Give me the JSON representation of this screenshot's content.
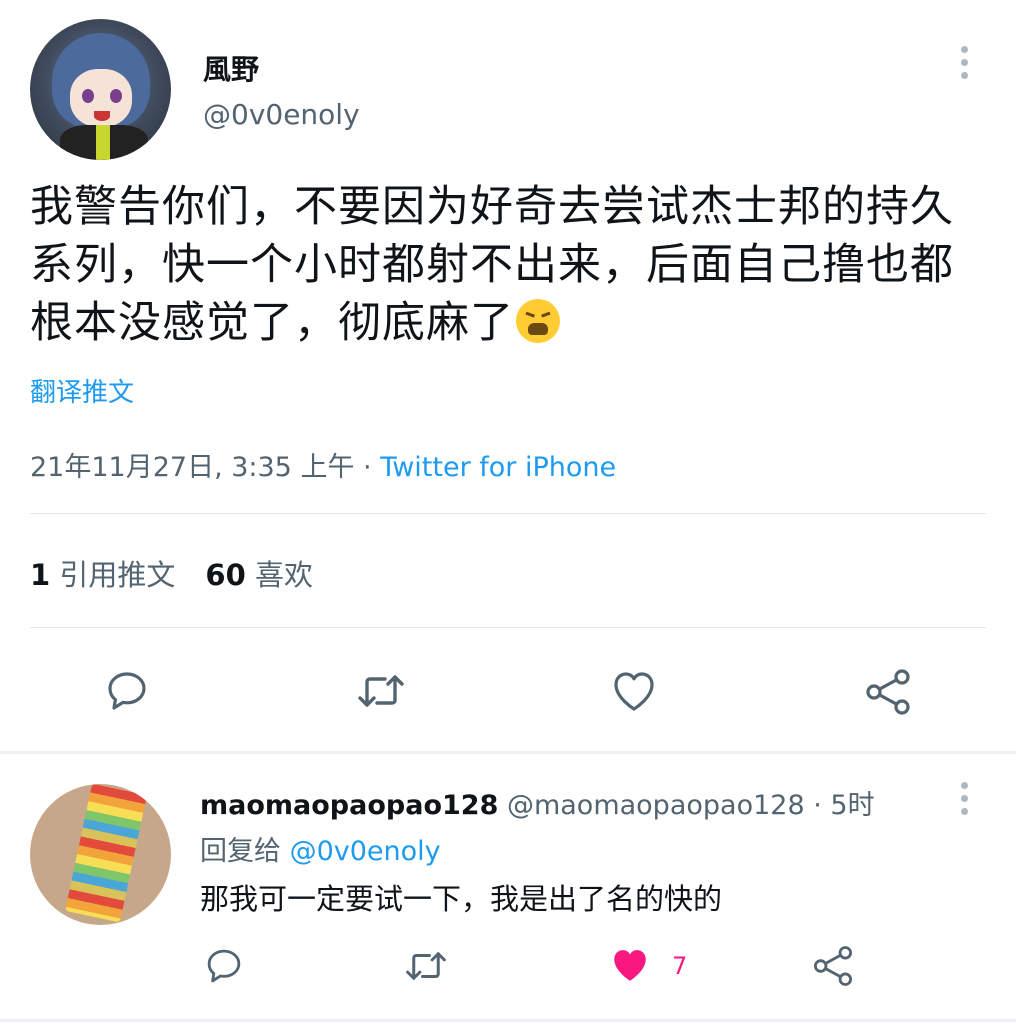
{
  "tweet": {
    "author_name": "風野",
    "author_handle": "@0v0enoly",
    "text": "我警告你们，不要因为好奇去尝试杰士邦的持久系列，快一个小时都射不出来，后面自己撸也都根本没感觉了，彻底麻了",
    "translate_label": "翻译推文",
    "timestamp": "21年11月27日, 3:35 上午",
    "separator": " · ",
    "source": "Twitter for iPhone",
    "quote_count": "1",
    "quote_label": "引用推文",
    "like_count": "60",
    "like_label": "喜欢"
  },
  "reply": {
    "author_name": "maomaopaopao128",
    "author_handle": "@maomaopaopao128",
    "time": " · 5时",
    "reply_to_label": "回复给",
    "reply_to_handle": "@0v0enoly",
    "text": "那我可一定要试一下，我是出了名的快的",
    "like_count": "7"
  },
  "icons": {
    "reply": "reply-icon",
    "retweet": "retweet-icon",
    "like": "heart-icon",
    "share": "share-icon",
    "more": "more-icon",
    "emoji": "weary-face-emoji"
  },
  "colors": {
    "link": "#1d9bf0",
    "secondary_text": "#536471",
    "like_active": "#f91880"
  }
}
